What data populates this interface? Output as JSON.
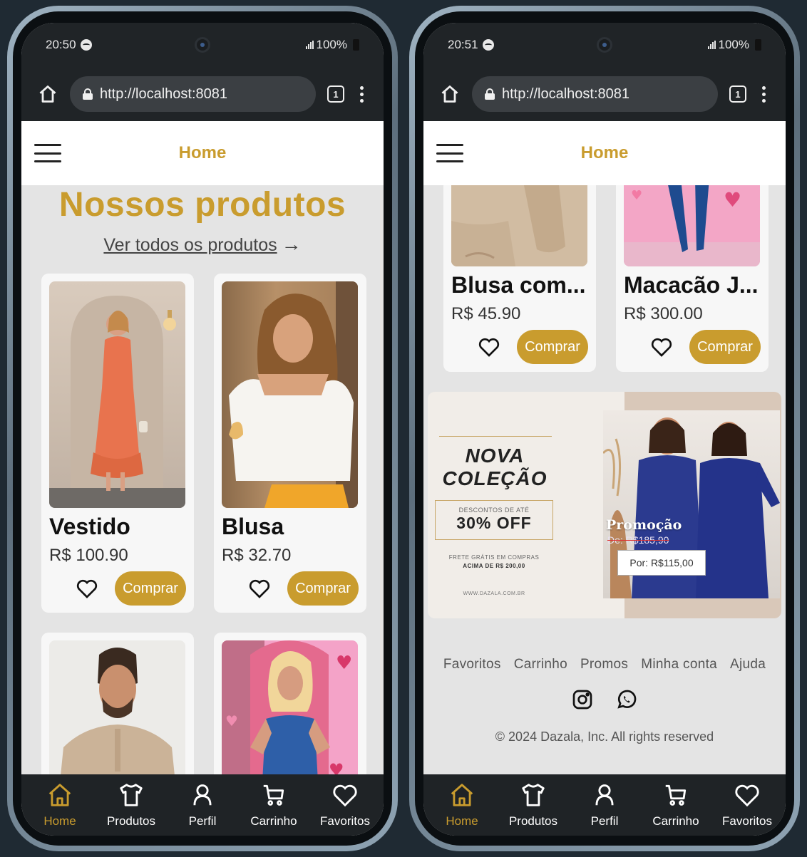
{
  "colors": {
    "accent": "#c99c2e",
    "nav_bg": "#1f2326",
    "page_bg": "#e4e4e4"
  },
  "phone1": {
    "status": {
      "time": "20:50",
      "battery": "100%"
    },
    "browser": {
      "url": "http://localhost:8081",
      "tab_count": "1"
    },
    "header": {
      "title": "Home"
    },
    "heading": "Nossos produtos",
    "see_all": {
      "label": "Ver todos os produtos",
      "arrow": "→"
    },
    "products": [
      {
        "name": "Vestido",
        "price": "R$ 100.90",
        "buy_label": "Comprar"
      },
      {
        "name": "Blusa",
        "price": "R$ 32.70",
        "buy_label": "Comprar"
      }
    ]
  },
  "phone2": {
    "status": {
      "time": "20:51",
      "battery": "100%"
    },
    "browser": {
      "url": "http://localhost:8081",
      "tab_count": "1"
    },
    "header": {
      "title": "Home"
    },
    "products": [
      {
        "name": "Blusa com...",
        "price": "R$ 45.90",
        "buy_label": "Comprar"
      },
      {
        "name": "Macacão J...",
        "price": "R$ 300.00",
        "buy_label": "Comprar"
      }
    ],
    "banner": {
      "line1": "NOVA",
      "line2": "COLEÇÃO",
      "discount_small": "DESCONTOS DE ATÉ",
      "discount_big": "30% OFF",
      "shipping1": "FRETE GRÁTIS EM COMPRAS",
      "shipping2": "ACIMA DE R$ 200,00",
      "site": "WWW.DAZALA.COM.BR",
      "promo_title": "Promoção",
      "old_price": "De: R$185,90",
      "new_price": "Por: R$115,00"
    },
    "footer": {
      "links": [
        "Favoritos",
        "Carrinho",
        "Promos",
        "Minha conta",
        "Ajuda"
      ],
      "social": [
        "instagram-icon",
        "whatsapp-icon"
      ],
      "copyright": "© 2024 Dazala, Inc. All rights reserved"
    }
  },
  "bottom_nav": [
    {
      "label": "Home",
      "icon": "home-icon",
      "active": true
    },
    {
      "label": "Produtos",
      "icon": "shirt-icon",
      "active": false
    },
    {
      "label": "Perfil",
      "icon": "person-icon",
      "active": false
    },
    {
      "label": "Carrinho",
      "icon": "cart-icon",
      "active": false
    },
    {
      "label": "Favoritos",
      "icon": "heart-icon",
      "active": false
    }
  ]
}
